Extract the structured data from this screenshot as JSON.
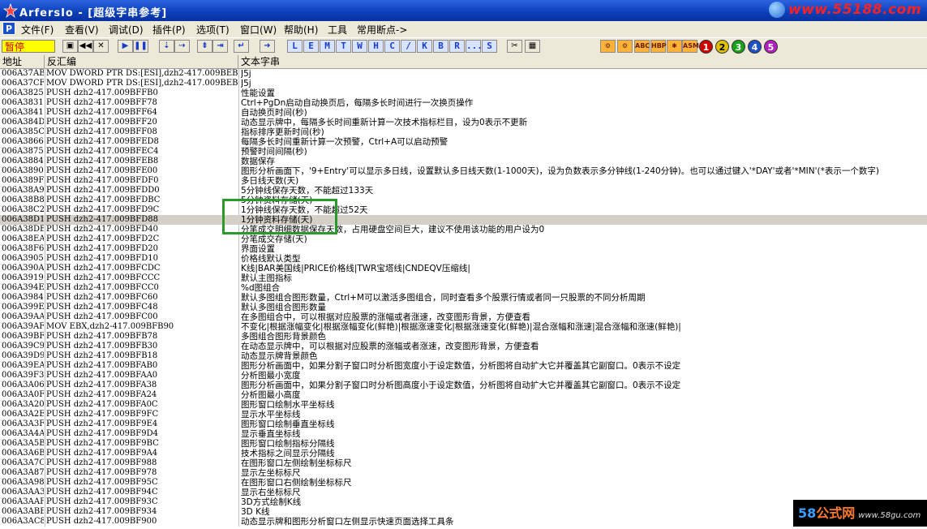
{
  "window": {
    "title": "ArfersIo - [超级字串参考]",
    "watermark": "www.55188.com"
  },
  "menu": [
    "文件(F)",
    "查看(V)",
    "调试(D)",
    "插件(P)",
    "选项(T)",
    "窗口(W)",
    "帮助(H)",
    "工具",
    "常用断点->"
  ],
  "toolbar": {
    "status": "暂停",
    "buttons": [
      "open-icon",
      "rewind-icon",
      "close-icon",
      "run-icon",
      "pause-icon",
      "step-into-icon",
      "step-over-icon",
      "trace-into-icon",
      "trace-over-icon",
      "execute-till-return-icon",
      "goto-icon"
    ],
    "letters": [
      "L",
      "E",
      "M",
      "T",
      "W",
      "H",
      "C",
      "/",
      "K",
      "B",
      "R",
      "...",
      "S"
    ],
    "extra_icons": [
      "scissors-icon",
      "grid-icon"
    ],
    "right_icons": [
      "plugin-icon-1",
      "plugin-icon-2",
      "abc-icon",
      "hbp-icon",
      "gear-icon",
      "asm-icon"
    ],
    "circle_buttons": [
      "1",
      "2",
      "3",
      "4",
      "5"
    ]
  },
  "columns": [
    "地址",
    "反汇编",
    "文本字串"
  ],
  "rows": [
    [
      "006A37AB",
      "MOV DWORD PTR DS:[ESI],dzh2-417.009BEBA0",
      "J5j"
    ],
    [
      "006A37CF",
      "MOV DWORD PTR DS:[ESI],dzh2-417.009BEBA0",
      "J5j"
    ],
    [
      "006A3825",
      "PUSH dzh2-417.009BFFB0",
      "性能设置"
    ],
    [
      "006A3831",
      "PUSH dzh2-417.009BFF78",
      "Ctrl+PgDn启动自动换页后，每隔多长时间进行一次换页操作"
    ],
    [
      "006A3841",
      "PUSH dzh2-417.009BFF64",
      "自动换页时间(秒)"
    ],
    [
      "006A384D",
      "PUSH dzh2-417.009BFF20",
      "动态显示牌中，每隔多长时间重新计算一次技术指标栏目，设为0表示不更新"
    ],
    [
      "006A385C",
      "PUSH dzh2-417.009BFF08",
      "指标排序更新时间(秒)"
    ],
    [
      "006A3866",
      "PUSH dzh2-417.009BFED8",
      "每隔多长时间重新计算一次预警，Ctrl+A可以启动预警"
    ],
    [
      "006A3875",
      "PUSH dzh2-417.009BFEC4",
      "预警时间间隔(秒)"
    ],
    [
      "006A3884",
      "PUSH dzh2-417.009BFEB8",
      "数据保存"
    ],
    [
      "006A3890",
      "PUSH dzh2-417.009BFE00",
      "图形分析画面下，'9+Entry'可以显示多日线，设置默认多日线天数(1-1000天)，设为负数表示多分钟线(1-240分钟)。也可以通过键入'*DAY'或者'*MIN'(*表示一个数字)"
    ],
    [
      "006A389F",
      "PUSH dzh2-417.009BFDF0",
      "多日线天数(天)"
    ],
    [
      "006A38A9",
      "PUSH dzh2-417.009BFDD0",
      "5分钟线保存天数，不能超过133天"
    ],
    [
      "006A38B8",
      "PUSH dzh2-417.009BFDBC",
      "5分钟资料存储(天)"
    ],
    [
      "006A38C2",
      "PUSH dzh2-417.009BFD9C",
      "1分钟线保存天数，不能超过52天"
    ],
    [
      "006A38D1",
      "PUSH dzh2-417.009BFD88",
      "1分钟资料存储(天)"
    ],
    [
      "006A38DB",
      "PUSH dzh2-417.009BFD40",
      "分笔成交明细数据保存天数，占用硬盘空间巨大，建议不使用该功能的用户设为0"
    ],
    [
      "006A38EA",
      "PUSH dzh2-417.009BFD2C",
      "分笔成交存储(天)"
    ],
    [
      "006A38F6",
      "PUSH dzh2-417.009BFD20",
      "界面设置"
    ],
    [
      "006A3905",
      "PUSH dzh2-417.009BFD10",
      "价格线默认类型"
    ],
    [
      "006A390A",
      "PUSH dzh2-417.009BFCDC",
      "K线|BAR美国线|PRICE价格线|TWR宝塔线|CNDEQV压缩线|"
    ],
    [
      "006A3919",
      "PUSH dzh2-417.009BFCCC",
      "默认主图指标"
    ],
    [
      "006A394E",
      "PUSH dzh2-417.009BFCC0",
      "%d图组合"
    ],
    [
      "006A3984",
      "PUSH dzh2-417.009BFC60",
      "默认多图组合图形数量，Ctrl+M可以激活多图组合，同时查看多个股票行情或者同一只股票的不同分析周期"
    ],
    [
      "006A399E",
      "PUSH dzh2-417.009BFC48",
      "默认多图组合图形数量"
    ],
    [
      "006A39AA",
      "PUSH dzh2-417.009BFC00",
      "在多图组合中，可以根据对应股票的涨幅或者涨速，改变图形背景，方便查看"
    ],
    [
      "006A39AF",
      "MOV EBX,dzh2-417.009BFB90",
      "不变化|根据涨幅变化|根据涨幅变化(鲜艳)|根据涨速变化|根据涨速变化(鲜艳)|混合涨幅和涨速|混合涨幅和涨速(鲜艳)|"
    ],
    [
      "006A39BF",
      "PUSH dzh2-417.009BFB78",
      "多图组合图形背景颜色"
    ],
    [
      "006A39C9",
      "PUSH dzh2-417.009BFB30",
      "在动态显示牌中，可以根据对应股票的涨幅或者涨速，改变图形背景，方便查看"
    ],
    [
      "006A39D9",
      "PUSH dzh2-417.009BFB18",
      "动态显示牌背景颜色"
    ],
    [
      "006A39EA",
      "PUSH dzh2-417.009BFAB0",
      "图形分析画面中，如果分割子窗口时分析图宽度小于设定数值，分析图将自动扩大它并覆盖其它副窗口。0表示不设定"
    ],
    [
      "006A39F3",
      "PUSH dzh2-417.009BFAA0",
      "分析图最小宽度"
    ],
    [
      "006A3A06",
      "PUSH dzh2-417.009BFA38",
      "图形分析画面中，如果分割子窗口时分析图高度小于设定数值，分析图将自动扩大它并覆盖其它副窗口。0表示不设定"
    ],
    [
      "006A3A0F",
      "PUSH dzh2-417.009BFA24",
      "分析图最小高度"
    ],
    [
      "006A3A20",
      "PUSH dzh2-417.009BFA0C",
      "图形窗口绘制水平坐标线"
    ],
    [
      "006A3A2E",
      "PUSH dzh2-417.009BF9FC",
      "显示水平坐标线"
    ],
    [
      "006A3A3F",
      "PUSH dzh2-417.009BF9E4",
      "图形窗口绘制垂直坐标线"
    ],
    [
      "006A3A4A",
      "PUSH dzh2-417.009BF9D4",
      "显示垂直坐标线"
    ],
    [
      "006A3A5B",
      "PUSH dzh2-417.009BF9BC",
      "图形窗口绘制指标分隔线"
    ],
    [
      "006A3A6B",
      "PUSH dzh2-417.009BF9A4",
      "技术指标之间显示分隔线"
    ],
    [
      "006A3A7C",
      "PUSH dzh2-417.009BF988",
      "在图形窗口左侧绘制坐标标尺"
    ],
    [
      "006A3A87",
      "PUSH dzh2-417.009BF978",
      "显示左坐标标尺"
    ],
    [
      "006A3A98",
      "PUSH dzh2-417.009BF95C",
      "在图形窗口右侧绘制坐标标尺"
    ],
    [
      "006A3AA3",
      "PUSH dzh2-417.009BF94C",
      "显示右坐标标尺"
    ],
    [
      "006A3AAF",
      "PUSH dzh2-417.009BF93C",
      "3D方式绘制K线"
    ],
    [
      "006A3ABE",
      "PUSH dzh2-417.009BF934",
      "3D K线"
    ],
    [
      "006A3AC8",
      "PUSH dzh2-417.009BF900",
      "动态显示牌和图形分析窗口左侧显示快速页面选择工具条"
    ]
  ],
  "highlighted_row_index": 15,
  "footer_watermark": {
    "num": "58",
    "cn": "公式网",
    "url": "www.58gu.com"
  },
  "colors": {
    "title_bar": "#0a3fb8",
    "status_bg": "#ffff00",
    "status_text": "#d00000",
    "annotation_box": "#2a9a2a",
    "selected_row": "#d4d0c8"
  }
}
